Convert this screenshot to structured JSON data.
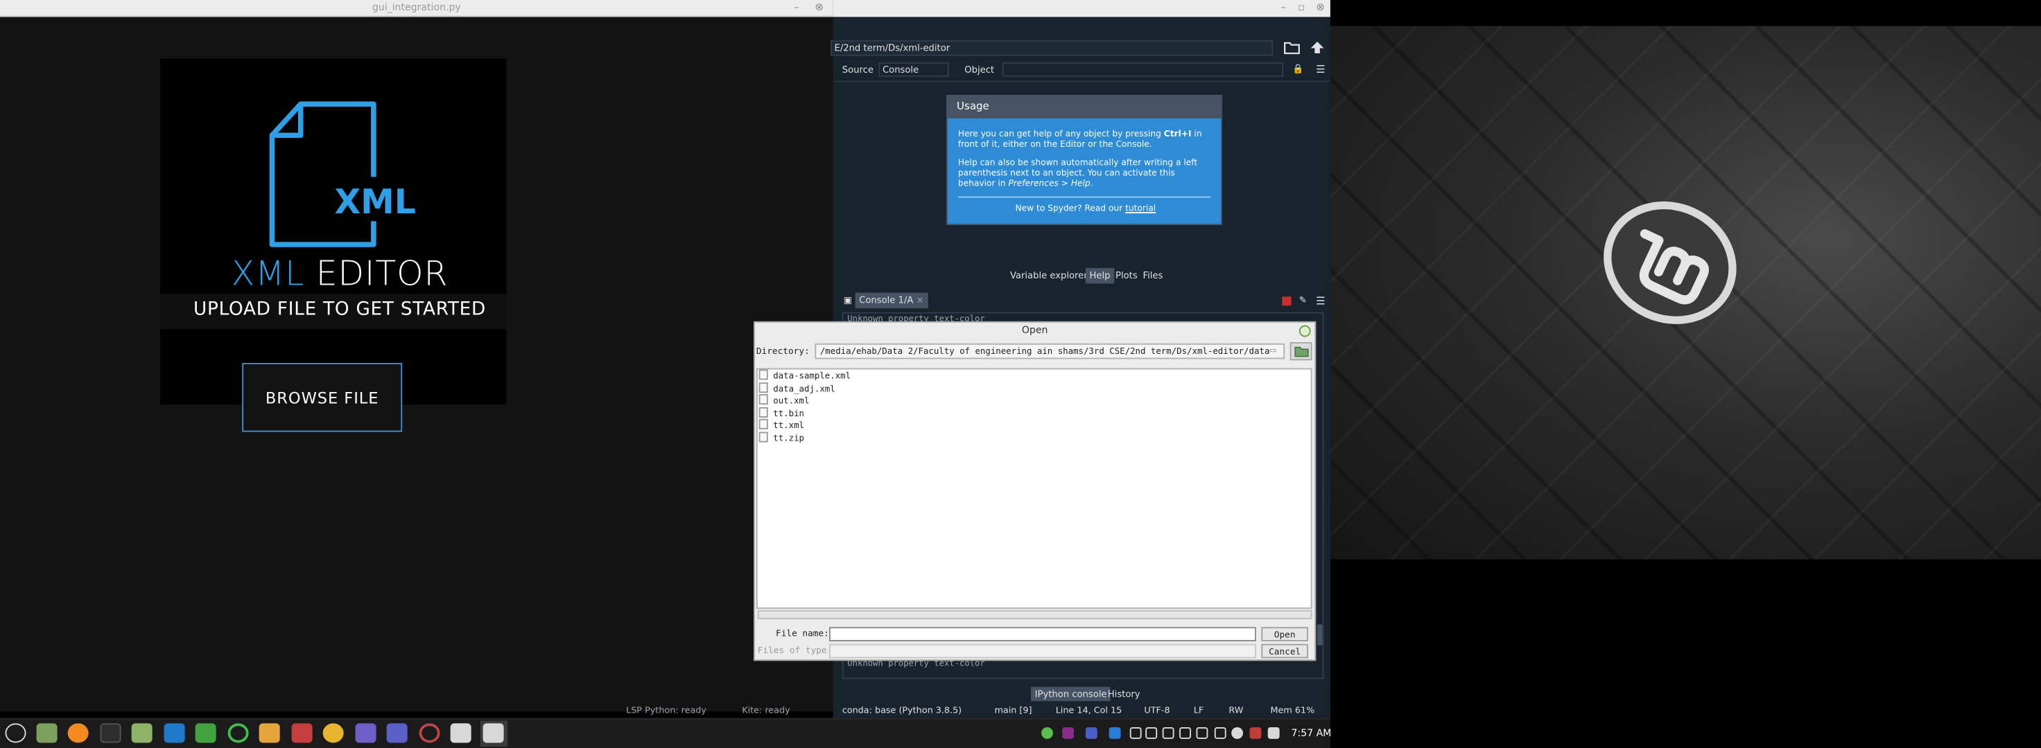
{
  "gui_window": {
    "title": "gui_integration.py",
    "app_title_accent": "XML",
    "app_title_rest": " EDITOR",
    "icon_text": "XML",
    "upload_text": "UPLOAD FILE TO GET STARTED",
    "browse_label": "BROWSE FILE"
  },
  "spyder": {
    "path": "E/2nd term/Ds/xml-editor",
    "toolbar": {
      "source_label": "Source",
      "source_value": "Console",
      "object_label": "Object",
      "object_value": ""
    },
    "usage": {
      "title": "Usage",
      "p1_a": "Here you can get help of any object by pressing ",
      "p1_key": "Ctrl+I",
      "p1_b": " in front of it, either on the Editor or the Console.",
      "p2_a": "Help can also be shown automatically after writing a left parenthesis next to an object. You can activate this behavior in ",
      "p2_pref": "Preferences > Help",
      "p2_b": ".",
      "footer_a": "New to Spyder? Read our ",
      "footer_link": "tutorial"
    },
    "pane_tabs": [
      "Variable explorer",
      "Help",
      "Plots",
      "Files"
    ],
    "console_tab": "Console 1/A",
    "console_line_top": "Unknown property text-color",
    "console_line_bottom": "Unknown property text-color",
    "bottom_tabs": [
      "IPython console",
      "History"
    ],
    "status": {
      "lsp": "LSP Python: ready",
      "kite": "Kite: ready",
      "conda": "conda: base (Python 3.8.5)",
      "git": "main [9]",
      "position": "Line 14, Col 15",
      "encoding": "UTF-8",
      "eol": "LF",
      "rw": "RW",
      "mem": "Mem 61%"
    }
  },
  "open_dialog": {
    "title": "Open",
    "directory_label": "Directory:",
    "directory_value": "/media/ehab/Data 2/Faculty of engineering ain shams/3rd CSE/2nd term/Ds/xml-editor/data",
    "files": [
      "data-sample.xml",
      "data_adj.xml",
      "out.xml",
      "tt.bin",
      "tt.xml",
      "tt.zip"
    ],
    "file_name_label": "File name:",
    "file_name_value": "",
    "files_of_type_label": "Files of type:",
    "open_label": "Open",
    "cancel_label": "Cancel"
  },
  "taskbar": {
    "clock": "7:57 AM",
    "icons": [
      "mint-menu-icon",
      "files-icon",
      "firefox-icon",
      "terminal-icon",
      "folder-icon",
      "vscode-icon",
      "qt-icon",
      "refresh-icon",
      "slack-icon",
      "apps-icon",
      "chrome-icon",
      "notes-icon",
      "teams-icon",
      "spyder-icon",
      "settings-icon",
      "settings-active-icon"
    ],
    "tray": [
      "update-icon",
      "bluetooth-icon",
      "network-icon",
      "volume-icon",
      "flag-icon"
    ]
  }
}
